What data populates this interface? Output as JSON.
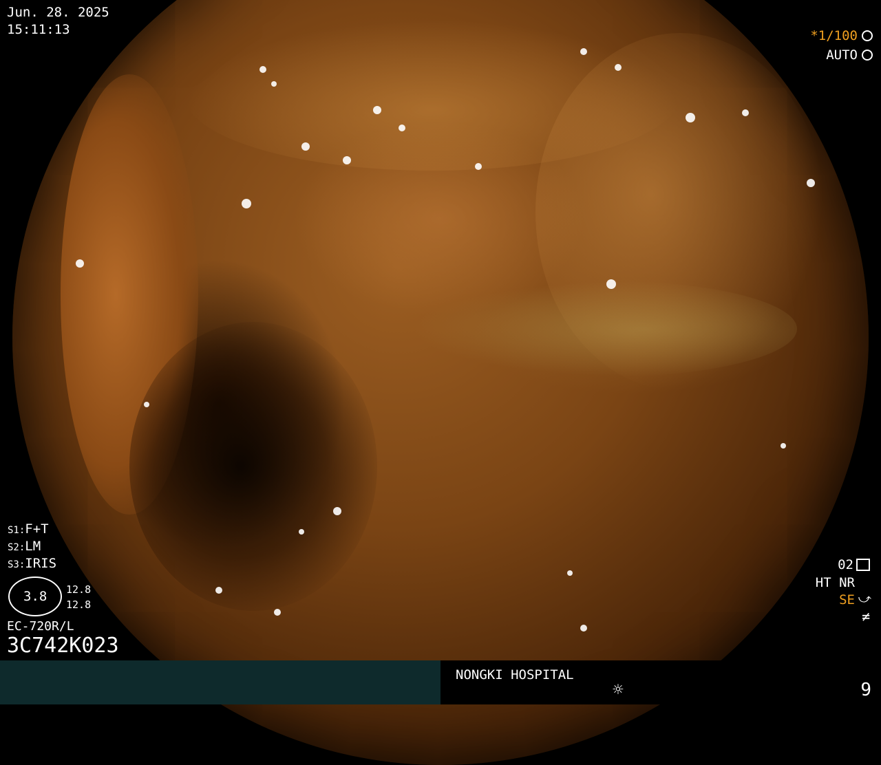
{
  "datetime": {
    "date": "Jun. 28. 2025",
    "time": "15:11:13"
  },
  "shutter": {
    "value": "*1/100",
    "mode": "AUTO",
    "shutter_icon": "aperture-icon",
    "mode_icon": "aperture-icon"
  },
  "settings": {
    "s1": {
      "key": "S1:",
      "value": "F+T"
    },
    "s2": {
      "key": "S2:",
      "value": "LM"
    },
    "s3": {
      "key": "S3:",
      "value": "IRIS"
    }
  },
  "scope_gauge": {
    "center_value": "3.8",
    "upper_value": "12.8",
    "lower_value": "12.8"
  },
  "device": {
    "model": "EC-720R/L",
    "serial": "3C742K023"
  },
  "right_status": {
    "code": "02",
    "line2": "HT NR",
    "se_label": "SE",
    "icons": [
      "settings-icon",
      "se-icon",
      "not-equal-icon"
    ]
  },
  "hospital": {
    "name": "NONGKI HOSPITAL",
    "page_number": "9",
    "brightness_icon": "sun-icon"
  },
  "colors": {
    "orange": "#f0a020",
    "bar_teal": "#0e2a2c",
    "text": "#ffffff"
  }
}
